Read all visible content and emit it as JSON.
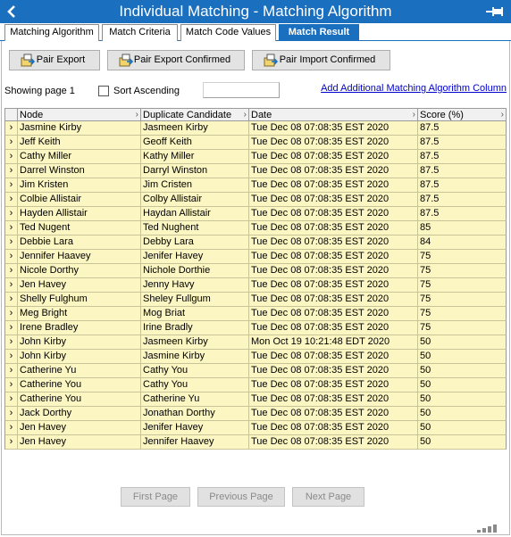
{
  "window": {
    "title": "Individual Matching - Matching Algorithm"
  },
  "icons": {
    "back": "back-arrow-icon",
    "pin": "pin-icon",
    "export": "export-icon",
    "signal": "signal-strength-icon",
    "accent": "#1a6fbf"
  },
  "tabs": [
    {
      "label": "Matching Algorithm"
    },
    {
      "label": "Match Criteria"
    },
    {
      "label": "Match Code Values"
    },
    {
      "label": "Match Result"
    }
  ],
  "toolbar": {
    "pair_export": "Pair Export",
    "pair_export_confirmed": "Pair Export Confirmed",
    "pair_import_confirmed": "Pair Import Confirmed"
  },
  "paging": {
    "showing": "Showing page 1",
    "sort_ascending": "Sort Ascending",
    "sort_ascending_checked": false,
    "page_value": "",
    "first": "First Page",
    "previous": "Previous Page",
    "next": "Next Page"
  },
  "add_column_link": "Add Additional Matching Algorithm Column",
  "grid": {
    "columns": [
      "Node",
      "Duplicate Candidate",
      "Date",
      "Score (%)"
    ],
    "rows": [
      [
        "Jasmine Kirby",
        "Jasmeen Kirby",
        "Tue Dec 08 07:08:35 EST 2020",
        "87.5"
      ],
      [
        "Jeff Keith",
        "Geoff Keith",
        "Tue Dec 08 07:08:35 EST 2020",
        "87.5"
      ],
      [
        "Cathy Miller",
        "Kathy Miller",
        "Tue Dec 08 07:08:35 EST 2020",
        "87.5"
      ],
      [
        "Darrel Winston",
        "Darryl Winston",
        "Tue Dec 08 07:08:35 EST 2020",
        "87.5"
      ],
      [
        "Jim Kristen",
        "Jim Cristen",
        "Tue Dec 08 07:08:35 EST 2020",
        "87.5"
      ],
      [
        "Colbie Allistair",
        "Colby Allistair",
        "Tue Dec 08 07:08:35 EST 2020",
        "87.5"
      ],
      [
        "Hayden Allistair",
        "Haydan Allistair",
        "Tue Dec 08 07:08:35 EST 2020",
        "87.5"
      ],
      [
        "Ted Nugent",
        "Ted Nughent",
        "Tue Dec 08 07:08:35 EST 2020",
        "85"
      ],
      [
        "Debbie Lara",
        "Debby Lara",
        "Tue Dec 08 07:08:35 EST 2020",
        "84"
      ],
      [
        "Jennifer Haavey",
        "Jenifer Havey",
        "Tue Dec 08 07:08:35 EST 2020",
        "75"
      ],
      [
        "Nicole Dorthy",
        "Nichole Dorthie",
        "Tue Dec 08 07:08:35 EST 2020",
        "75"
      ],
      [
        "Jen Havey",
        "Jenny Havy",
        "Tue Dec 08 07:08:35 EST 2020",
        "75"
      ],
      [
        "Shelly Fulghum",
        "Sheley Fullgum",
        "Tue Dec 08 07:08:35 EST 2020",
        "75"
      ],
      [
        "Meg Bright",
        "Mog Briat",
        "Tue Dec 08 07:08:35 EST 2020",
        "75"
      ],
      [
        "Irene Bradley",
        "Irine Bradly",
        "Tue Dec 08 07:08:35 EST 2020",
        "75"
      ],
      [
        "John Kirby",
        "Jasmeen Kirby",
        "Mon Oct 19 10:21:48 EDT 2020",
        "50"
      ],
      [
        "John Kirby",
        "Jasmine Kirby",
        "Tue Dec 08 07:08:35 EST 2020",
        "50"
      ],
      [
        "Catherine Yu",
        "Cathy You",
        "Tue Dec 08 07:08:35 EST 2020",
        "50"
      ],
      [
        "Catherine You",
        "Cathy You",
        "Tue Dec 08 07:08:35 EST 2020",
        "50"
      ],
      [
        "Catherine You",
        "Catherine Yu",
        "Tue Dec 08 07:08:35 EST 2020",
        "50"
      ],
      [
        "Jack Dorthy",
        "Jonathan Dorthy",
        "Tue Dec 08 07:08:35 EST 2020",
        "50"
      ],
      [
        "Jen Havey",
        "Jenifer Havey",
        "Tue Dec 08 07:08:35 EST 2020",
        "50"
      ],
      [
        "Jen Havey",
        "Jennifer Haavey",
        "Tue Dec 08 07:08:35 EST 2020",
        "50"
      ]
    ]
  }
}
